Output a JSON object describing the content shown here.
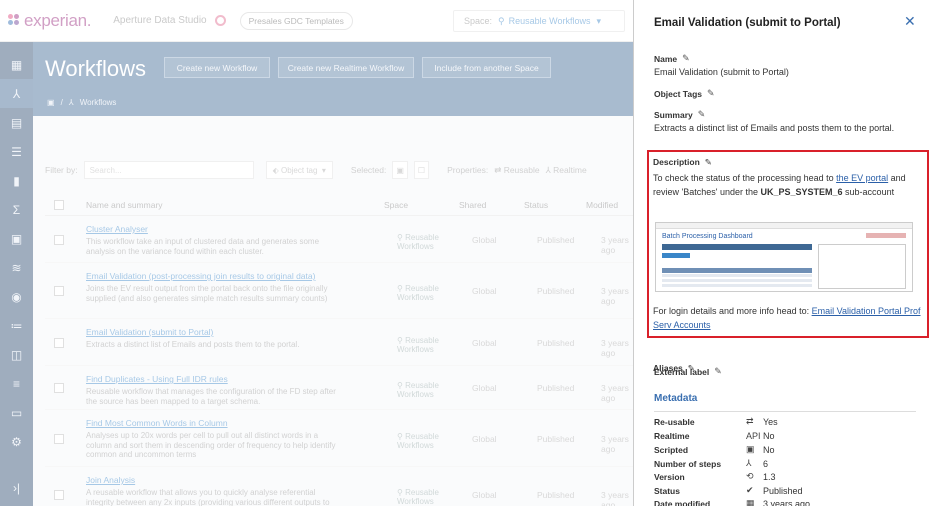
{
  "topbar": {
    "logo": "experian.",
    "app_name": "Aperture Data Studio",
    "template": "Presales GDC Templates",
    "space_label": "Space:",
    "space_value": "Reusable Workflows"
  },
  "header": {
    "title": "Workflows",
    "buttons": [
      "Create new Workflow",
      "Create new Realtime Workflow",
      "Include from another Space"
    ],
    "breadcrumb": "Workflows"
  },
  "filters": {
    "filter_by": "Filter by:",
    "search_placeholder": "Search...",
    "object_tag": "Object tag",
    "selected": "Selected:",
    "properties": "Properties:",
    "reusable": "Reusable",
    "realtime": "Realtime"
  },
  "table": {
    "columns": [
      "Name and summary",
      "Space",
      "Shared",
      "Status",
      "Modified"
    ],
    "rows": [
      {
        "name": "Cluster Analyser",
        "summary": "This workflow take an input of clustered data and generates some analysis on the variance found within each cluster.",
        "space": "Reusable Workflows",
        "shared": "Global",
        "status": "Published",
        "modified": "3 years ago"
      },
      {
        "name": "Email Validation (post-processing join results to original data)",
        "summary": "Joins the EV result output from the portal back onto the file originally supplied (and also generates simple match results summary counts)",
        "space": "Reusable Workflows",
        "shared": "Global",
        "status": "Published",
        "modified": "3 years ago"
      },
      {
        "name": "Email Validation (submit to Portal)",
        "summary": "Extracts a distinct list of Emails and posts them to the portal.",
        "space": "Reusable Workflows",
        "shared": "Global",
        "status": "Published",
        "modified": "3 years ago"
      },
      {
        "name": "Find Duplicates - Using Full IDR rules",
        "summary": "Reusable workflow that manages the configuration of the FD step after the source has been mapped to a target schema.",
        "space": "Reusable Workflows",
        "shared": "Global",
        "status": "Published",
        "modified": "3 years ago"
      },
      {
        "name": "Find Most Common Words in Column",
        "summary": "Analyses up to 20x words per cell to pull out all distinct words in a column and sort them in descending order of frequency to help identify common and uncommon terms",
        "space": "Reusable Workflows",
        "shared": "Global",
        "status": "Published",
        "modified": "3 years ago"
      },
      {
        "name": "Join Analysis",
        "summary": "A reusable workflow that allows you to quickly analyse referential integrity between any 2x inputs (providing various different outputs to provide counts and common types of join)",
        "space": "Reusable Workflows",
        "shared": "Global",
        "status": "Published",
        "modified": "3 years ago"
      }
    ]
  },
  "panel": {
    "title": "Email Validation (submit to Portal)",
    "name_label": "Name",
    "name_value": "Email Validation (submit to Portal)",
    "tags_label": "Object Tags",
    "summary_label": "Summary",
    "summary_value": "Extracts a distinct list of Emails and posts them to the portal.",
    "description_label": "Description",
    "desc_p1_a": "To check the status of the processing head to ",
    "desc_p1_link": "the EV portal",
    "desc_p1_b": " and review 'Batches' under the ",
    "desc_p1_bold": "UK_PS_SYSTEM_6",
    "desc_p1_c": " sub-account",
    "desc_p2_a": "For login details and more info head to: ",
    "desc_p2_link": "Email Validation Portal Prof Serv Accounts",
    "thumb_title": "Batch Processing Dashboard",
    "external_label": "External label",
    "aliases_label": "Aliases",
    "metadata_title": "Metadata",
    "metadata": [
      {
        "key": "Re-usable",
        "icon": "reusable-icon",
        "glyph": "⇄",
        "value": "Yes"
      },
      {
        "key": "Realtime",
        "icon": "api-icon",
        "glyph": "API",
        "value": "No"
      },
      {
        "key": "Scripted",
        "icon": "script-icon",
        "glyph": "▣",
        "value": "No"
      },
      {
        "key": "Number of steps",
        "icon": "steps-icon",
        "glyph": "⅄",
        "value": "6"
      },
      {
        "key": "Version",
        "icon": "history-icon",
        "glyph": "⟲",
        "value": "1.3"
      },
      {
        "key": "Status",
        "icon": "status-icon",
        "glyph": "✔",
        "value": "Published"
      },
      {
        "key": "Date modified",
        "icon": "calendar-icon",
        "glyph": "▦",
        "value": "3 years ago"
      }
    ]
  },
  "colors": {
    "sidebar": "#2b4a6f",
    "header": "#3e6894",
    "accent": "#3a6fb0",
    "highlight_border": "#d9202a"
  }
}
